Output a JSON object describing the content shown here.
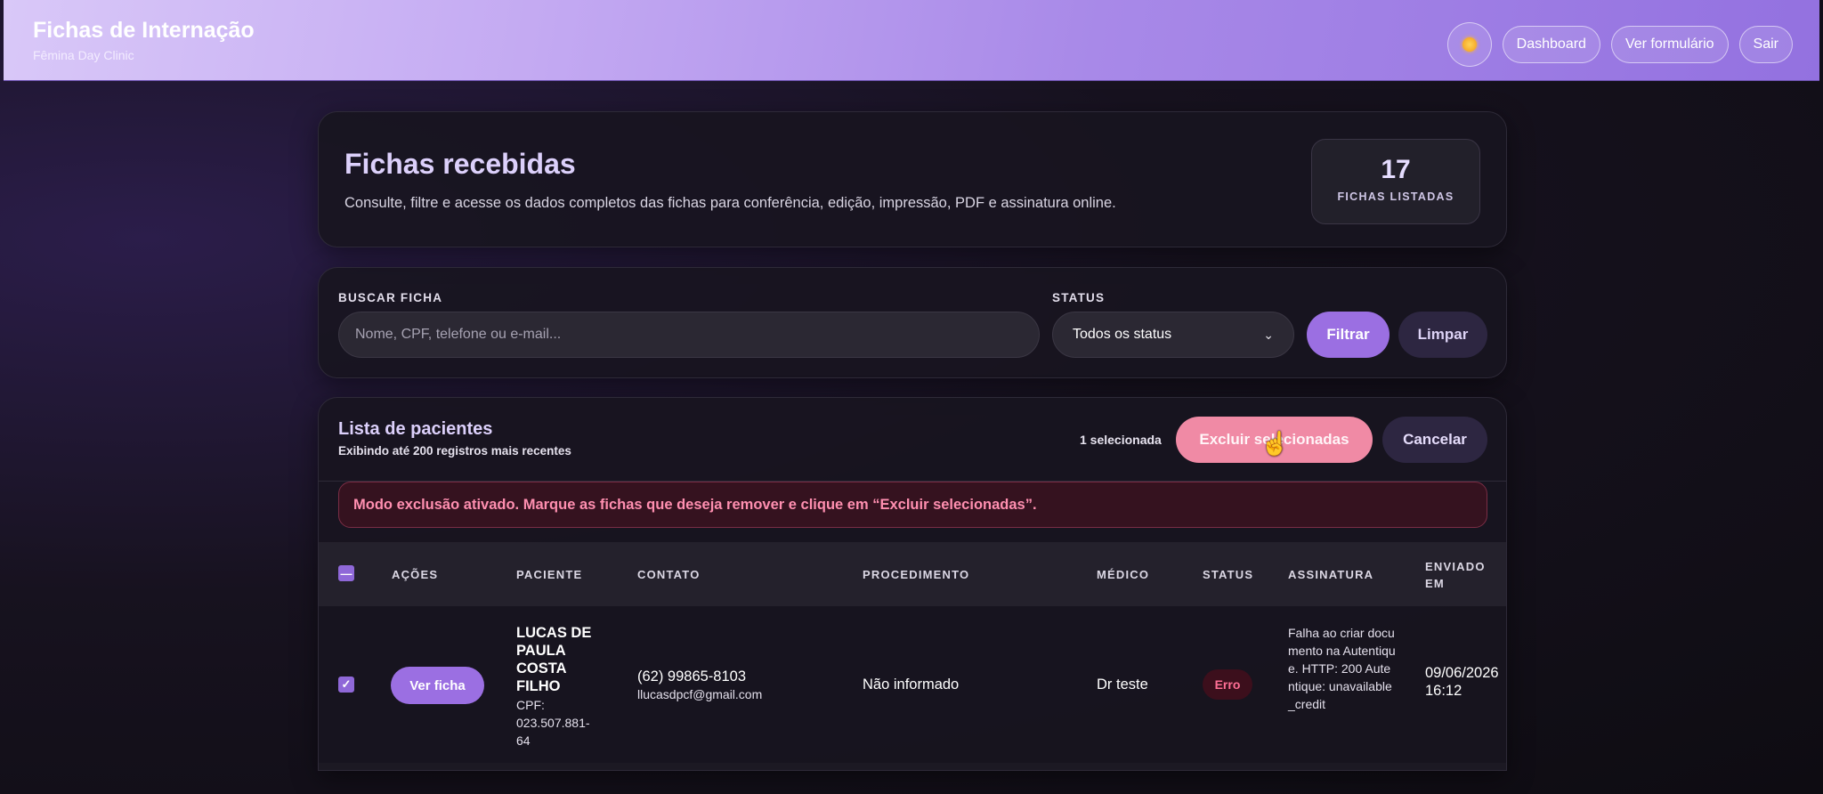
{
  "header": {
    "title": "Fichas de Internação",
    "subtitle": "Fêmina Day Clinic",
    "nav": {
      "dashboard": "Dashboard",
      "form": "Ver formulário",
      "logout": "Sair"
    }
  },
  "hero": {
    "title": "Fichas recebidas",
    "description": "Consulte, filtre e acesse os dados completos das fichas para conferência, edição, impressão, PDF e assinatura online.",
    "count": "17",
    "count_label": "FICHAS LISTADAS"
  },
  "filters": {
    "search_label": "BUSCAR FICHA",
    "search_placeholder": "Nome, CPF, telefone ou e-mail...",
    "search_value": "",
    "status_label": "STATUS",
    "status_selected": "Todos os status",
    "filter_button": "Filtrar",
    "clear_button": "Limpar"
  },
  "list": {
    "title": "Lista de pacientes",
    "subtitle": "Exibindo até 200 registros mais recentes",
    "selected_count": "1 selecionada",
    "delete_button": "Excluir selecionadas",
    "cancel_button": "Cancelar",
    "alert": "Modo exclusão ativado. Marque as fichas que deseja remover e clique em “Excluir selecionadas”.",
    "columns": {
      "actions": "AÇÕES",
      "patient": "PACIENTE",
      "contact": "CONTATO",
      "procedure": "PROCEDIMENTO",
      "doctor": "MÉDICO",
      "status": "STATUS",
      "signature": "ASSINATURA",
      "sent_at_1": "ENVIADO",
      "sent_at_2": "EM"
    },
    "rows": [
      {
        "action": "Ver ficha",
        "patient": "LUCAS DE PAULA COSTA FILHO",
        "cpf": "CPF: 023.507.881-64",
        "phone": "(62) 99865-8103",
        "email": "llucasdpcf@gmail.com",
        "procedure": "Não informado",
        "doctor": "Dr teste",
        "status": "Erro",
        "signature": "Falha ao criar documento na Autentique. HTTP: 200 Autentique: unavailable_credit",
        "sent_date": "09/06/2026",
        "sent_time": "16:12"
      }
    ]
  },
  "colors": {
    "accent": "#9b6fe2",
    "danger": "#f08aa5",
    "status_error": "#ff6f95"
  }
}
